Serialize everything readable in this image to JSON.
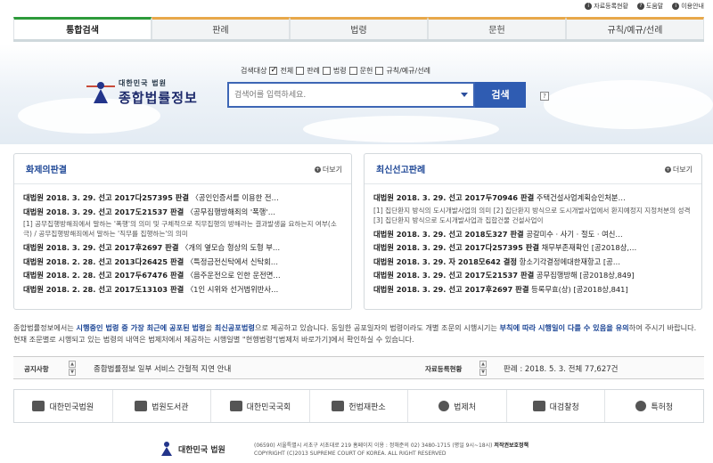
{
  "util": {
    "items": [
      "자료등록현황",
      "도움말",
      "이용안내"
    ]
  },
  "tabs": [
    "통합검색",
    "판례",
    "법령",
    "문헌",
    "규칙/예규/선례"
  ],
  "logo": {
    "small": "대한민국 법원",
    "big": "종합법률정보"
  },
  "search": {
    "scope_label": "검색대상",
    "options": [
      "전체",
      "판례",
      "법령",
      "문헌",
      "규칙/예규/선례"
    ],
    "placeholder": "검색어를 입력하세요.",
    "button": "검색",
    "help": "?"
  },
  "left_panel": {
    "title": "화제의판결",
    "more": "더보기",
    "items": [
      {
        "src": "대법원 2018. 3. 29. 선고 2017다257395 판결",
        "text": " 〈공인인증서를 이용한 전…"
      },
      {
        "src": "대법원 2018. 3. 29. 선고 2017도21537 판결",
        "text": " 〈공무집행방해죄의 '폭행'…"
      },
      {
        "sub": "[1] 공무집행방해죄에서 말하는 '폭행'의 의미 및 구체적으로 직무집행의 방해라는 결과발생을 요하는지 여부(소극) / 공무집행방해죄에서 말하는 '직무를 집행하는'의 의미"
      },
      {
        "src": "대법원 2018. 3. 29. 선고 2017후2697 판결",
        "text": " 〈개의 옆모습 형상의 도형 부…"
      },
      {
        "src": "대법원 2018. 2. 28. 선고 2013다26425 판결",
        "text": " 〈특정금전신탁에서 신탁회…"
      },
      {
        "src": "대법원 2018. 2. 28. 선고 2017두67476 판결",
        "text": " 〈음주운전으로 인한 운전면…"
      },
      {
        "src": "대법원 2018. 2. 28. 선고 2017도13103 판결",
        "text": " 〈1인 시위와 선거법위반사…"
      }
    ]
  },
  "right_panel": {
    "title": "최신선고판례",
    "more": "더보기",
    "items": [
      {
        "src": "대법원 2018. 3. 29. 선고 2017두70946 판결",
        "text": " 주택건설사업계획승인처분…"
      },
      {
        "sub": "[1] 집단환지 방식의 도시개발사업의 의미 [2] 집단환지 방식으로 도시개발사업에서 환지예정지 지정처분의 성격 [3] 집단환지 방식으로 도시개발사업과 집합건물 건설사업이"
      },
      {
        "src": "대법원 2018. 3. 29. 선고 2018도327 판결",
        "text": " 공갈미수 · 사기 · 절도 · 여신…"
      },
      {
        "src": "대법원 2018. 3. 29. 선고 2017다257395 판결",
        "text": " 채무부존재확인 [공2018상,…"
      },
      {
        "src": "대법원 2018. 3. 29. 자 2018모642 결정",
        "text": " 항소기각결정에대한재항고 [공…"
      },
      {
        "src": "대법원 2018. 3. 29. 선고 2017도21537 판결",
        "text": " 공무집행방해 [공2018상,849]"
      },
      {
        "src": "대법원 2018. 3. 29. 선고 2017후2697 판결",
        "text": " 등록무효(상) [공2018상,841]"
      }
    ]
  },
  "notice": {
    "p1": "종합법률정보에서는 ",
    "b1": "시행중인 법령 중 가장 최근에 공포된 법령",
    "p2": "을 ",
    "b2": "최신공포법령",
    "p3": "으로 제공하고 있습니다. 동일한 공포일자의 법령이라도 개별 조문의 시행시기는 ",
    "b3": "부칙에 따라 시행일이 다를 수 있음을 유의",
    "p4": "하여 주시기 바랍니다. 현재 조문별로 시행되고 있는 법령의 내역은 법제처에서 제공하는 시행일별 \"현행법령\"[법제처 바로가기]에서 확인하실 수 있습니다."
  },
  "bar": {
    "notice_label": "공지사항",
    "notice_text": "종합법률정보 일부 서비스 간헐적 지연 안내",
    "stat_label": "자료등록현황",
    "stat_text": "판례 : 2018. 5. 3. 전체 77,627건"
  },
  "links": [
    "대한민국법원",
    "법원도서관",
    "대한민국국회",
    "헌법재판소",
    "법제처",
    "대검찰청",
    "특허청"
  ],
  "footer": {
    "logo": "대한민국 법원",
    "addr_line": "(06590) 서울특별시 서초구 서초대로 219   홈페이지 이용 : 정해준의 02) 3480-1715 (평일 9시~18시)",
    "policy": "저작권보호정책",
    "copyright": "COPYRIGHT (C)2013 SUPREME COURT OF KOREA.  ALL RIGHT RESERVED"
  }
}
